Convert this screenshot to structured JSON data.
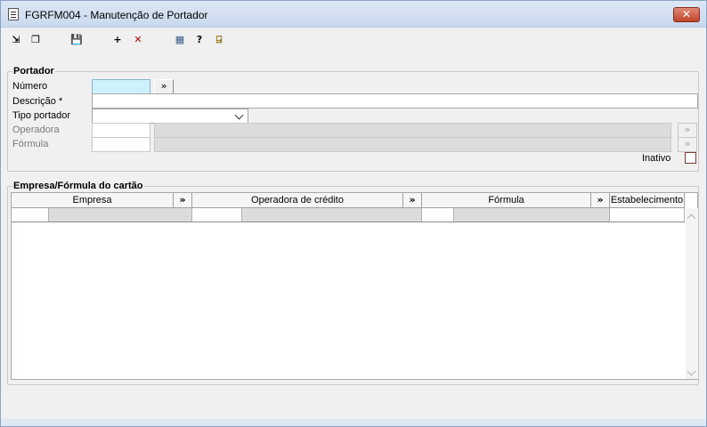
{
  "window": {
    "title": "FGRFM004 - Manutenção de Portador",
    "close_glyph": "✕"
  },
  "toolbar": {
    "items": [
      {
        "name": "first-record-icon",
        "glyph": "⇲"
      },
      {
        "name": "copy-record-icon",
        "glyph": "❐"
      },
      {
        "name": "save-icon",
        "glyph": "💾"
      },
      {
        "name": "add-icon",
        "glyph": "+"
      },
      {
        "name": "delete-icon",
        "glyph": "✕"
      },
      {
        "name": "calendar-grid-icon",
        "glyph": "▦"
      },
      {
        "name": "help-icon",
        "glyph": "?"
      },
      {
        "name": "exit-door-icon",
        "glyph": "⍈"
      }
    ],
    "delete_color": "#b30000"
  },
  "portador": {
    "legend": "Portador",
    "numero_label": "Número",
    "numero_value": "",
    "lookup_glyph": "»",
    "descricao_label": "Descrição *",
    "descricao_value": "",
    "tipo_label": "Tipo portador",
    "tipo_value": "",
    "operadora_label": "Operadora",
    "formula_label": "Fórmula",
    "inativo_label": "Inativo",
    "highlight_color": "#cdf2fb"
  },
  "empresa": {
    "legend": "Empresa/Fórmula do cartão",
    "columns": [
      "Empresa",
      "»",
      "Operadora de crédito",
      "»",
      "Fórmula",
      "»",
      "Estabelecimento"
    ]
  }
}
